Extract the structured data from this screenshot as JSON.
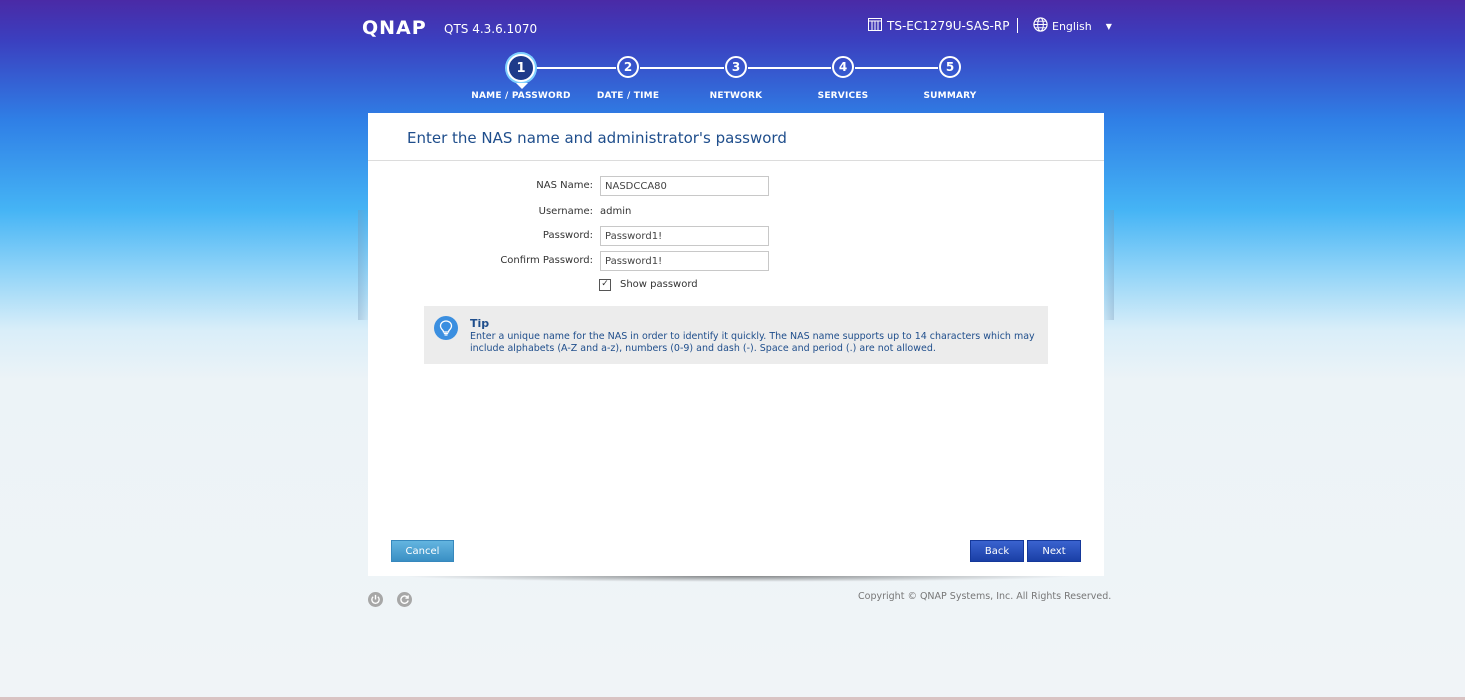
{
  "header": {
    "logo": "QNAP",
    "version": "QTS 4.3.6.1070",
    "device": "TS-EC1279U-SAS-RP",
    "language": "English"
  },
  "steps": [
    {
      "number": "1",
      "label": "NAME / PASSWORD",
      "active": true
    },
    {
      "number": "2",
      "label": "DATE / TIME",
      "active": false
    },
    {
      "number": "3",
      "label": "NETWORK",
      "active": false
    },
    {
      "number": "4",
      "label": "SERVICES",
      "active": false
    },
    {
      "number": "5",
      "label": "SUMMARY",
      "active": false
    }
  ],
  "form": {
    "title": "Enter the NAS name and administrator's password",
    "nas_name_label": "NAS Name:",
    "nas_name_value": "NASDCCA80",
    "username_label": "Username:",
    "username_value": "admin",
    "password_label": "Password:",
    "password_value": "Password1!",
    "confirm_label": "Confirm Password:",
    "confirm_value": "Password1!",
    "show_password_label": "Show password",
    "show_password_checked": true
  },
  "tip": {
    "title": "Tip",
    "text": "Enter a unique name for the NAS in order to identify it quickly. The NAS name supports up to 14 characters which may include alphabets (A-Z and a-z), numbers (0-9) and dash (-). Space and period (.) are not allowed."
  },
  "buttons": {
    "cancel": "Cancel",
    "back": "Back",
    "next": "Next"
  },
  "footer": {
    "copyright": "Copyright © QNAP Systems, Inc. All Rights Reserved."
  },
  "colors": {
    "title_blue": "#1f4e8c",
    "button_blue": "#1a3fa6",
    "cancel_blue": "#3a8fc4"
  }
}
